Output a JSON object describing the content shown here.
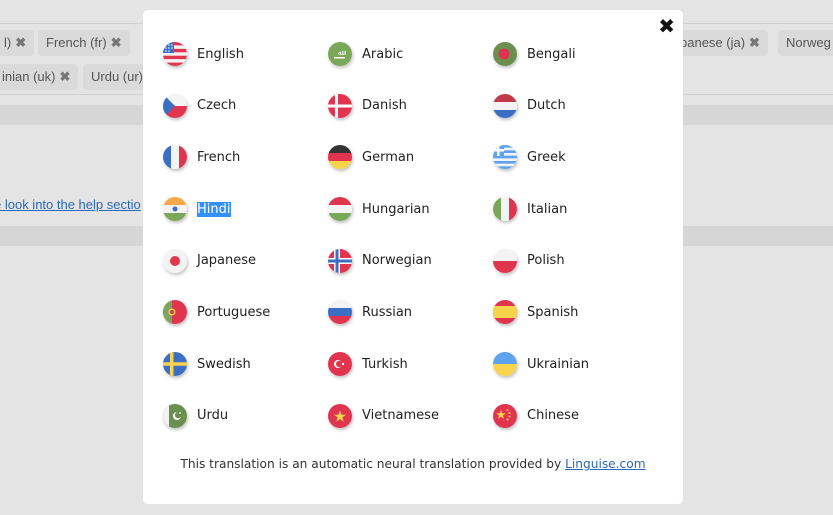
{
  "background": {
    "chips_row1": [
      {
        "label": "l)",
        "left": true
      },
      {
        "label": "French (fr)"
      },
      {
        "label": "panese (ja)"
      },
      {
        "label": "Norweg"
      }
    ],
    "chips_row2": [
      {
        "label": "inian (uk)"
      },
      {
        "label": "Urdu (ur)"
      }
    ],
    "help_link": "e look into the help sectio"
  },
  "modal": {
    "close_label": "✖",
    "languages": [
      {
        "name": "English",
        "flag": "us"
      },
      {
        "name": "Arabic",
        "flag": "sa"
      },
      {
        "name": "Bengali",
        "flag": "bd"
      },
      {
        "name": "Czech",
        "flag": "cz"
      },
      {
        "name": "Danish",
        "flag": "dk"
      },
      {
        "name": "Dutch",
        "flag": "nl"
      },
      {
        "name": "French",
        "flag": "fr"
      },
      {
        "name": "German",
        "flag": "de"
      },
      {
        "name": "Greek",
        "flag": "gr"
      },
      {
        "name": "Hindi",
        "flag": "in",
        "selected": true
      },
      {
        "name": "Hungarian",
        "flag": "hu"
      },
      {
        "name": "Italian",
        "flag": "it"
      },
      {
        "name": "Japanese",
        "flag": "jp"
      },
      {
        "name": "Norwegian",
        "flag": "no"
      },
      {
        "name": "Polish",
        "flag": "pl"
      },
      {
        "name": "Portuguese",
        "flag": "pt"
      },
      {
        "name": "Russian",
        "flag": "ru"
      },
      {
        "name": "Spanish",
        "flag": "es"
      },
      {
        "name": "Swedish",
        "flag": "se"
      },
      {
        "name": "Turkish",
        "flag": "tr"
      },
      {
        "name": "Ukrainian",
        "flag": "ua"
      },
      {
        "name": "Urdu",
        "flag": "pk"
      },
      {
        "name": "Vietnamese",
        "flag": "vn"
      },
      {
        "name": "Chinese",
        "flag": "cn"
      }
    ],
    "footer_text": "This translation is an automatic neural translation provided by ",
    "footer_link": "Linguise.com"
  },
  "colors": {
    "overlay_bg": "#e4e4e4",
    "selection": "#3390ff",
    "link": "#2a6ab8",
    "flag_red": "#e0344f",
    "flag_blue": "#3b6fc4",
    "flag_green": "#7ba75a",
    "flag_yellow": "#f7d44c"
  }
}
